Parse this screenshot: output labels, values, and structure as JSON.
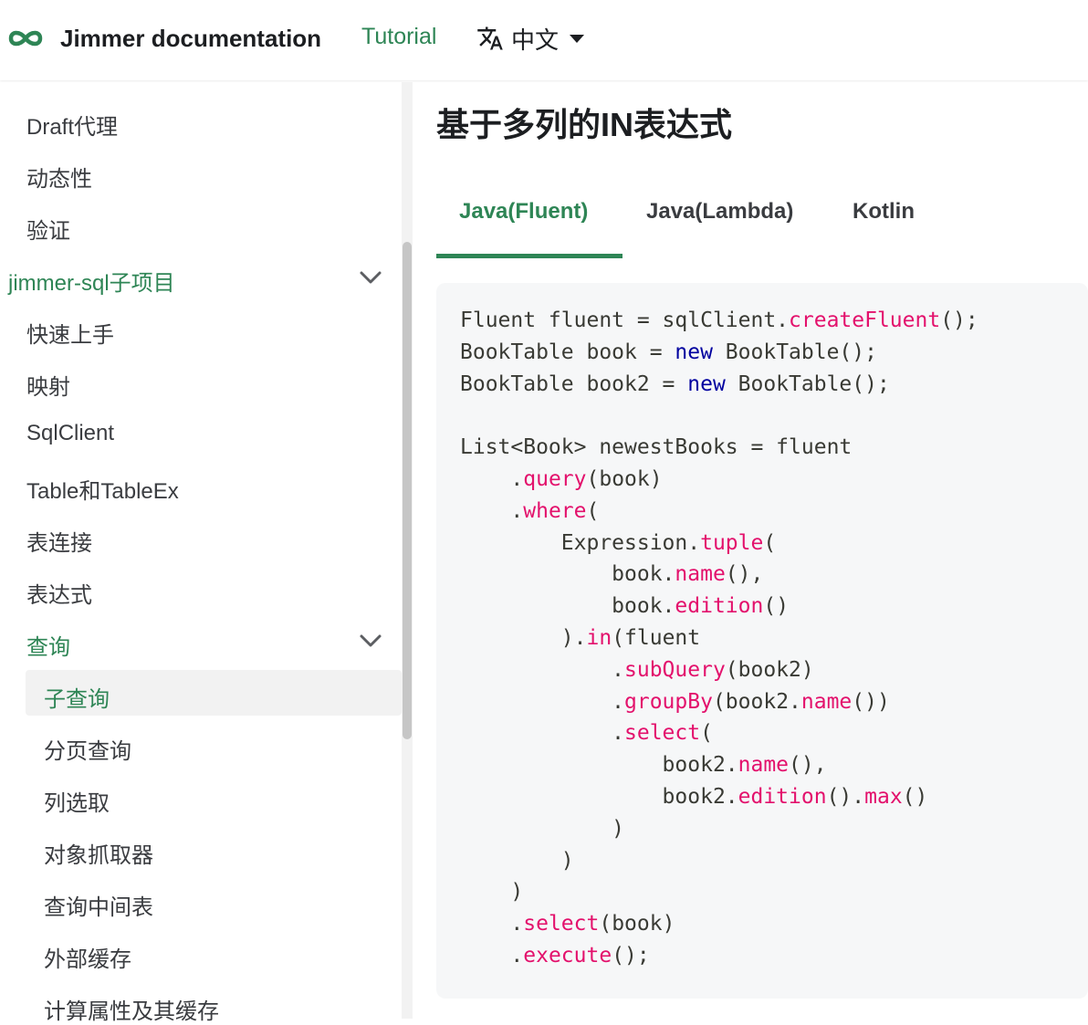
{
  "navbar": {
    "brand_title": "Jimmer documentation",
    "tutorial_label": "Tutorial",
    "language_label": "中文"
  },
  "sidebar": {
    "items_top": [
      "Draft代理",
      "动态性",
      "验证"
    ],
    "category_sql": "jimmer-sql子项目",
    "items_sql": [
      "快速上手",
      "映射",
      "SqlClient",
      "Table和TableEx",
      "表连接",
      "表达式"
    ],
    "category_query": "查询",
    "items_query": [
      "子查询",
      "分页查询",
      "列选取",
      "对象抓取器",
      "查询中间表",
      "外部缓存",
      "计算属性及其缓存"
    ]
  },
  "content": {
    "title": "基于多列的IN表达式",
    "tabs": [
      "Java(Fluent)",
      "Java(Lambda)",
      "Kotlin"
    ],
    "active_tab": "Java(Fluent)"
  },
  "code_lines": [
    [
      [
        "Fluent fluent = sqlClient.",
        ""
      ],
      [
        "createFluent",
        "red"
      ],
      [
        "();",
        ""
      ]
    ],
    [
      [
        "BookTable book = ",
        ""
      ],
      [
        "new",
        "blue"
      ],
      [
        " BookTable();",
        ""
      ]
    ],
    [
      [
        "BookTable book2 = ",
        ""
      ],
      [
        "new",
        "blue"
      ],
      [
        " BookTable();",
        ""
      ]
    ],
    [
      [
        "",
        ""
      ]
    ],
    [
      [
        "List<Book> newestBooks = fluent",
        ""
      ]
    ],
    [
      [
        "    .",
        ""
      ],
      [
        "query",
        "red"
      ],
      [
        "(book)",
        ""
      ]
    ],
    [
      [
        "    .",
        ""
      ],
      [
        "where",
        "red"
      ],
      [
        "(",
        ""
      ]
    ],
    [
      [
        "        Expression.",
        ""
      ],
      [
        "tuple",
        "red"
      ],
      [
        "(",
        ""
      ]
    ],
    [
      [
        "            book.",
        ""
      ],
      [
        "name",
        "red"
      ],
      [
        "(),",
        ""
      ]
    ],
    [
      [
        "            book.",
        ""
      ],
      [
        "edition",
        "red"
      ],
      [
        "()",
        ""
      ]
    ],
    [
      [
        "        ).",
        ""
      ],
      [
        "in",
        "red"
      ],
      [
        "(fluent",
        ""
      ]
    ],
    [
      [
        "            .",
        ""
      ],
      [
        "subQuery",
        "red"
      ],
      [
        "(book2)",
        ""
      ]
    ],
    [
      [
        "            .",
        ""
      ],
      [
        "groupBy",
        "red"
      ],
      [
        "(book2.",
        ""
      ],
      [
        "name",
        "red"
      ],
      [
        "())",
        ""
      ]
    ],
    [
      [
        "            .",
        ""
      ],
      [
        "select",
        "red"
      ],
      [
        "(",
        ""
      ]
    ],
    [
      [
        "                book2.",
        ""
      ],
      [
        "name",
        "red"
      ],
      [
        "(),",
        ""
      ]
    ],
    [
      [
        "                book2.",
        ""
      ],
      [
        "edition",
        "red"
      ],
      [
        "().",
        ""
      ],
      [
        "max",
        "red"
      ],
      [
        "()",
        ""
      ]
    ],
    [
      [
        "            )",
        ""
      ]
    ],
    [
      [
        "        )",
        ""
      ]
    ],
    [
      [
        "    )",
        ""
      ]
    ],
    [
      [
        "    .",
        ""
      ],
      [
        "select",
        "red"
      ],
      [
        "(book)",
        ""
      ]
    ],
    [
      [
        "    .",
        ""
      ],
      [
        "execute",
        "red"
      ],
      [
        "();",
        ""
      ]
    ]
  ],
  "colors": {
    "accent": "#2e8555",
    "keyword_red": "#e3116c",
    "keyword_blue": "#00009f",
    "code_bg": "#f6f7f8"
  },
  "icons": [
    "jimmer-logo-icon",
    "translate-icon",
    "caret-down-icon",
    "chevron-down-icon"
  ]
}
